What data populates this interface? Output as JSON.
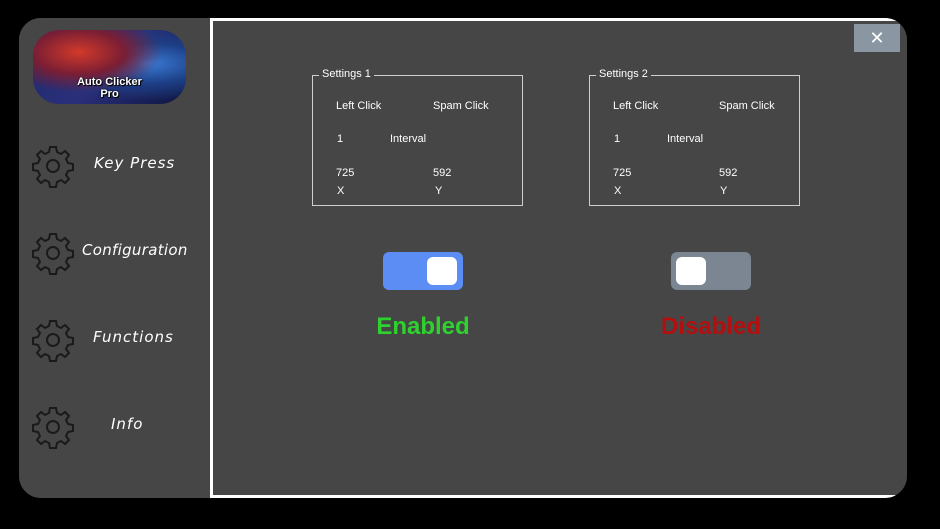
{
  "app": {
    "logo_text_line1": "Auto Clicker",
    "logo_text_line2": "Pro"
  },
  "sidebar": {
    "items": [
      {
        "label": "Key Press",
        "icon": "gear-icon"
      },
      {
        "label": "Configuration",
        "icon": "gear-icon"
      },
      {
        "label": "Functions",
        "icon": "gear-icon"
      },
      {
        "label": "Info",
        "icon": "gear-icon"
      }
    ]
  },
  "window": {
    "close_label": "✕"
  },
  "settings": [
    {
      "title": "Settings 1",
      "click_type": "Left Click",
      "click_mode": "Spam Click",
      "interval_value": "1",
      "interval_label": "Interval",
      "x_value": "725",
      "y_value": "592",
      "x_label": "X",
      "y_label": "Y",
      "toggle_on": true,
      "status": "Enabled",
      "status_color": "#2ed12e"
    },
    {
      "title": "Settings 2",
      "click_type": "Left Click",
      "click_mode": "Spam Click",
      "interval_value": "1",
      "interval_label": "Interval",
      "x_value": "725",
      "y_value": "592",
      "x_label": "X",
      "y_label": "Y",
      "toggle_on": false,
      "status": "Disabled",
      "status_color": "#b40f0f"
    }
  ],
  "colors": {
    "toggle_on": "#5b8df5",
    "toggle_off": "#7b8692"
  }
}
